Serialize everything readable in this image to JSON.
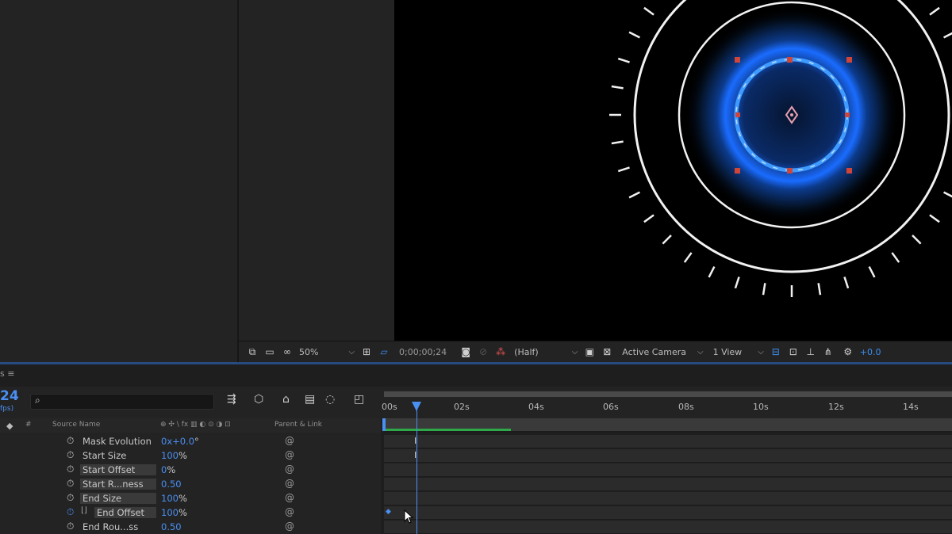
{
  "viewer_bar": {
    "zoom": "50%",
    "timecode": "0;00;00;24",
    "resolution": "(Half)",
    "camera": "Active Camera",
    "view": "1 View",
    "exposure": "+0.0"
  },
  "timeline": {
    "tab_label": "s ≡",
    "timecode": "24",
    "fps": "fps)",
    "columns": {
      "hash": "#",
      "source_name": "Source Name",
      "switches": "⊕ ✣ \\ fx ▥ ◐ ⊙ ◑ ⊡",
      "parent_link": "Parent & Link"
    },
    "ruler_ticks": [
      "00s",
      "02s",
      "04s",
      "06s",
      "08s",
      "10s",
      "12s",
      "14s"
    ]
  },
  "properties": [
    {
      "name": "Mask Evolution",
      "value": "0x+0.0",
      "unit": "°",
      "highlight": false,
      "keyframed": false
    },
    {
      "name": "Start Size",
      "value": "100",
      "unit": "%",
      "highlight": false,
      "keyframed": false
    },
    {
      "name": "Start Offset",
      "value": "0",
      "unit": "%",
      "highlight": true,
      "keyframed": false
    },
    {
      "name": "Start R...ness",
      "value": "0.50",
      "unit": "",
      "highlight": true,
      "keyframed": false
    },
    {
      "name": "End Size",
      "value": "100",
      "unit": "%",
      "highlight": true,
      "keyframed": false
    },
    {
      "name": "End Offset",
      "value": "100",
      "unit": "%",
      "highlight": true,
      "keyframed": true
    },
    {
      "name": "End Rou...ss",
      "value": "0.50",
      "unit": "",
      "highlight": false,
      "keyframed": false
    }
  ],
  "colors": {
    "accent": "#4a8ff2",
    "glow": "#2f7cff",
    "work_area_bar": "#2fa84a",
    "anchor_handles": "#d0453a"
  }
}
